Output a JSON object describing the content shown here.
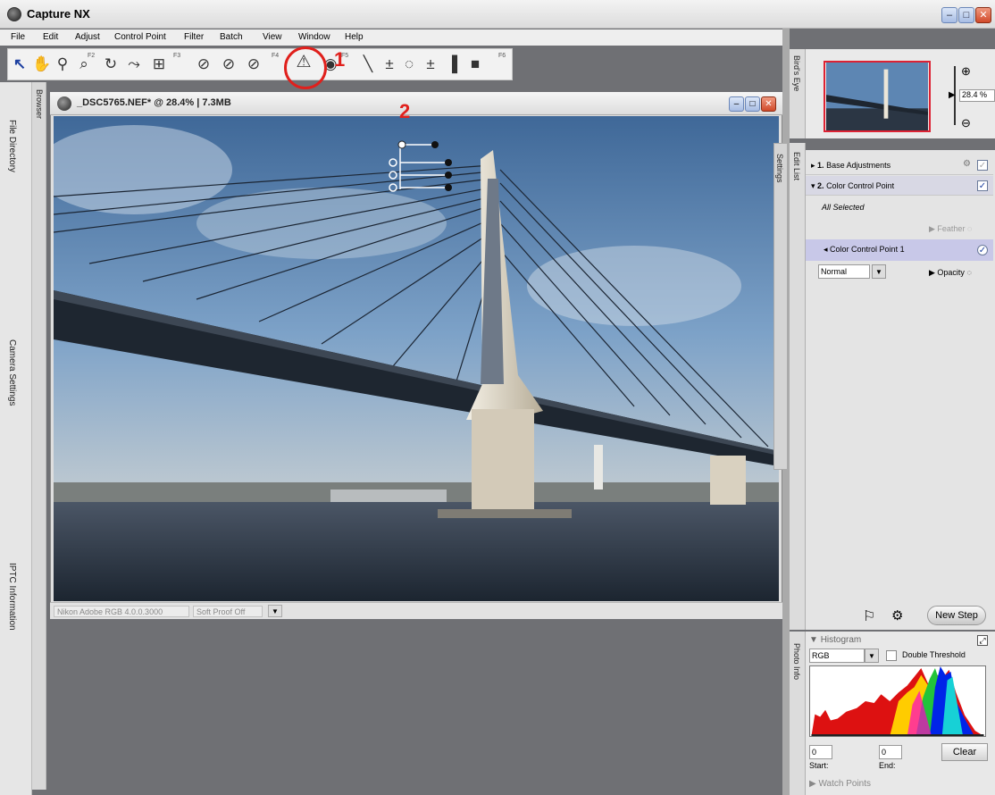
{
  "window": {
    "title": "Capture NX",
    "min": "–",
    "max": "□",
    "close": "✕"
  },
  "menu": [
    "File",
    "Edit",
    "Adjust",
    "Control Point",
    "Filter",
    "Batch",
    "View",
    "Window",
    "Help"
  ],
  "toolbar": {
    "group_labels": [
      "F2",
      "F3",
      "F4",
      "F5",
      "F6"
    ]
  },
  "annotations": {
    "step1": "1",
    "step2": "2"
  },
  "left_panels": {
    "browser": "Browser",
    "file_directory": "File Directory",
    "camera_settings": "Camera Settings",
    "iptc": "IPTC Information"
  },
  "document": {
    "title": "_DSC5765.NEF* @ 28.4% | 7.3MB",
    "color_profile": "Nikon Adobe RGB 4.0.0.3000",
    "soft_proof": "Soft Proof Off"
  },
  "birds_eye": {
    "tab": "Bird's Eye",
    "zoom": "28.4",
    "zoom_unit": "%"
  },
  "settings_tab": "Settings",
  "edit_list": {
    "tab": "Edit List",
    "steps": [
      {
        "num": "1.",
        "label": "Base Adjustments"
      },
      {
        "num": "2.",
        "label": "Color Control Point"
      }
    ],
    "all_selected": "All Selected",
    "feather": "Feather",
    "control_point": "Color Control Point 1",
    "blend_mode": "Normal",
    "opacity": "Opacity",
    "new_step": "New Step"
  },
  "histogram": {
    "tab": "Photo Info",
    "title": "Histogram",
    "channel": "RGB",
    "double_threshold": "Double Threshold",
    "start_value": "0",
    "end_value": "0",
    "start_label": "Start:",
    "end_label": "End:",
    "clear": "Clear",
    "watch_points": "Watch Points"
  },
  "colors": {
    "accent_red": "#e0201c",
    "window_blue": "#a8bde4",
    "close_red": "#d14a2a"
  }
}
